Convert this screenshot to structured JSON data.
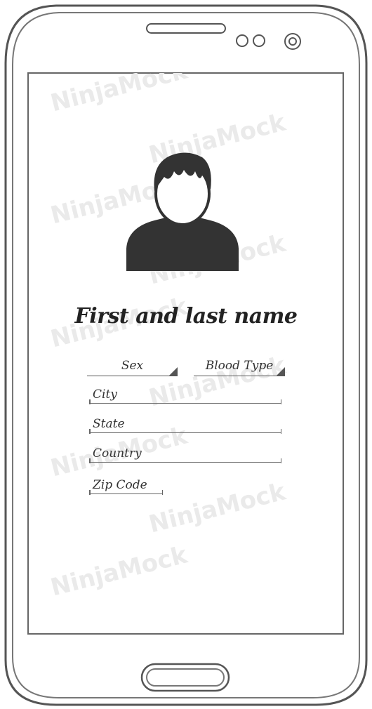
{
  "profile": {
    "name": "First and last name"
  },
  "selects": {
    "sex": "Sex",
    "blood_type": "Blood Type"
  },
  "fields": {
    "city": "City",
    "state": "State",
    "country": "Country",
    "zip": "Zip Code"
  },
  "watermark": {
    "brand": "NinjaMock"
  },
  "icons": {
    "avatar": "user-avatar-icon",
    "speaker": "speaker-slot-icon",
    "sensor": "sensor-dots-icon",
    "camera": "front-camera-icon",
    "home": "home-button-icon"
  },
  "colors": {
    "outline": "#555555",
    "avatar": "#333333",
    "watermark": "#eaeaea"
  }
}
